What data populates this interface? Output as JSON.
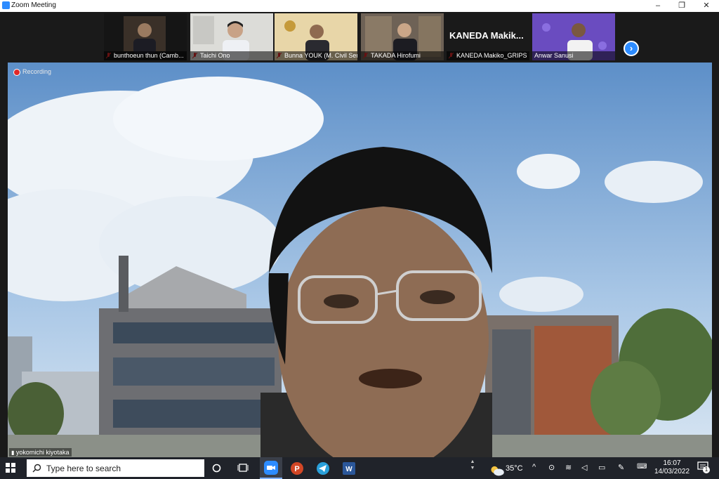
{
  "window": {
    "title": "Zoom Meeting",
    "minimize": "–",
    "restore": "❐",
    "close": "✕"
  },
  "participants": [
    {
      "name": "bunthoeun thun (Camb..."
    },
    {
      "name": "Taichi Ono"
    },
    {
      "name": "Bunna YOUK (M. Civil Servi..."
    },
    {
      "name": "TAKADA Hirofumi"
    },
    {
      "name": "KANEDA Makiko_GRIPS",
      "display": "KANEDA Makik..."
    },
    {
      "name": "Anwar Sanusi"
    }
  ],
  "strip": {
    "next_icon": "chevron-right-icon",
    "next_glyph": "›"
  },
  "main": {
    "recording_label": "Recording",
    "speaker_name": "yokomichi kiyotaka"
  },
  "taskbar": {
    "search_placeholder": "Type here to search",
    "weather": "35°C",
    "time": "16:07",
    "date": "14/03/2022",
    "notification_count": "1"
  },
  "colors": {
    "zoom_blue": "#2d8cff",
    "taskbar": "#20232a",
    "recording": "#e02828"
  }
}
